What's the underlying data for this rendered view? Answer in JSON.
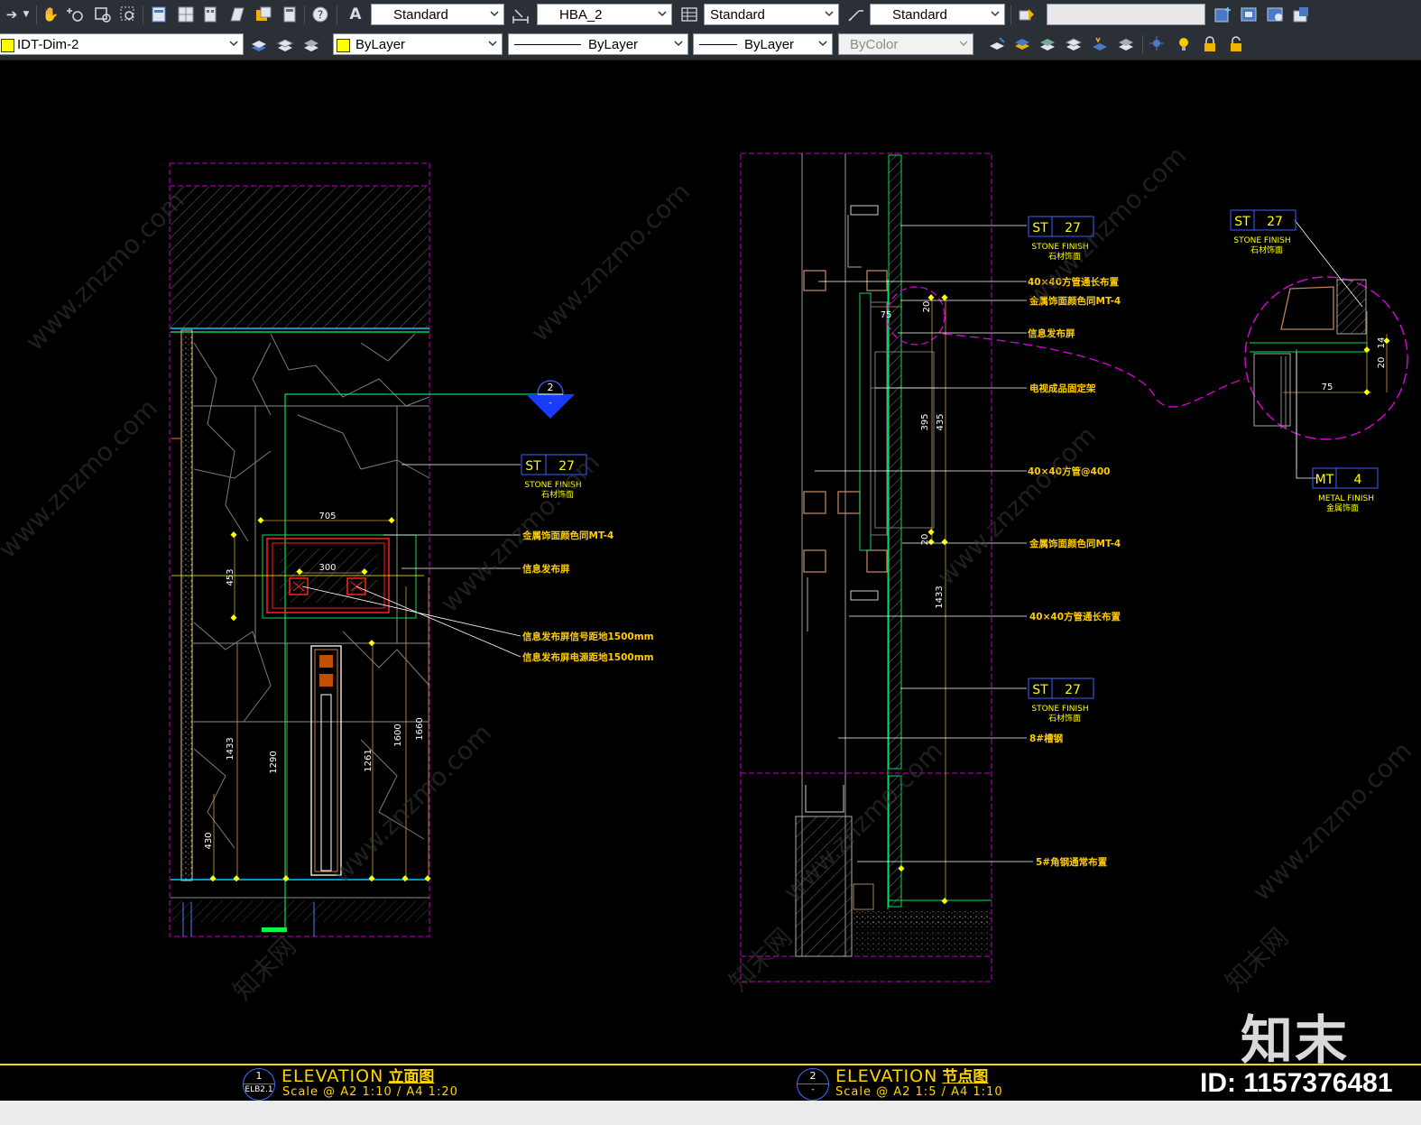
{
  "toolbar": {
    "text_style": "Standard",
    "dim_style": "HBA_2",
    "table_style": "Standard",
    "multileader_style": "Standard",
    "search_value": "",
    "layer": "IDT-Dim-2",
    "color": "ByLayer",
    "linetype": "ByLayer",
    "lineweight": "ByLayer",
    "plot_style": "ByColor",
    "colors": {
      "layer_swatch": "#ffff00"
    }
  },
  "drawing": {
    "tags": {
      "st_code": "ST",
      "st_num": "27",
      "mt_code": "MT",
      "mt_num": "4",
      "stone_finish_en": "STONE FINISH",
      "stone_finish_cn": "石材饰面",
      "metal_finish_en": "METAL FINISH",
      "metal_finish_cn": "金属饰面"
    },
    "section_marker": {
      "num": "2",
      "sheet": "-"
    },
    "left_notes": {
      "metal_color": "金属饰面颜色同MT-4",
      "info_screen": "信息发布屏",
      "signal_height": "信息发布屏信号距地1500mm",
      "power_height": "信息发布屏电源距地1500mm"
    },
    "right_notes": {
      "tube_long_1": "40×40方管通长布置",
      "metal_color_1": "金属饰面颜色同MT-4",
      "info_screen": "信息发布屏",
      "tv_bracket": "电视成品固定架",
      "tube_400": "40×40方管@400",
      "metal_color_2": "金属饰面颜色同MT-4",
      "tube_long_2": "40×40方管通长布置",
      "hanger": "8#槽钢",
      "angle_steel": "5#角钢通常布置"
    },
    "left_dims": {
      "w705": "705",
      "w300": "300",
      "h453": "453",
      "h1433": "1433",
      "h1290": "1290",
      "h1261": "1261",
      "h1600": "1600",
      "h1660": "1660",
      "h430": "430"
    },
    "right_dims": {
      "d75": "75",
      "d20": "20",
      "d395": "395",
      "d435": "435",
      "d20b": "20",
      "d1433": "1433"
    },
    "detail_dims": {
      "d75": "75",
      "d20": "20",
      "d14": "14"
    }
  },
  "titles": [
    {
      "num": "1",
      "sheet": "ELB2.1",
      "label_en": "ELEVATION",
      "label_cn": "立面图",
      "scale": "Scale @ A2 1:10 / A4 1:20"
    },
    {
      "num": "2",
      "sheet": "-",
      "label_en": "ELEVATION",
      "label_cn": "节点图",
      "scale": "Scale @ A2 1:5 / A4 1:10"
    }
  ],
  "watermark": {
    "logo": "知末",
    "id": "ID: 1157376481",
    "site": "www.znzmo.com",
    "site_cn": "知末网"
  }
}
